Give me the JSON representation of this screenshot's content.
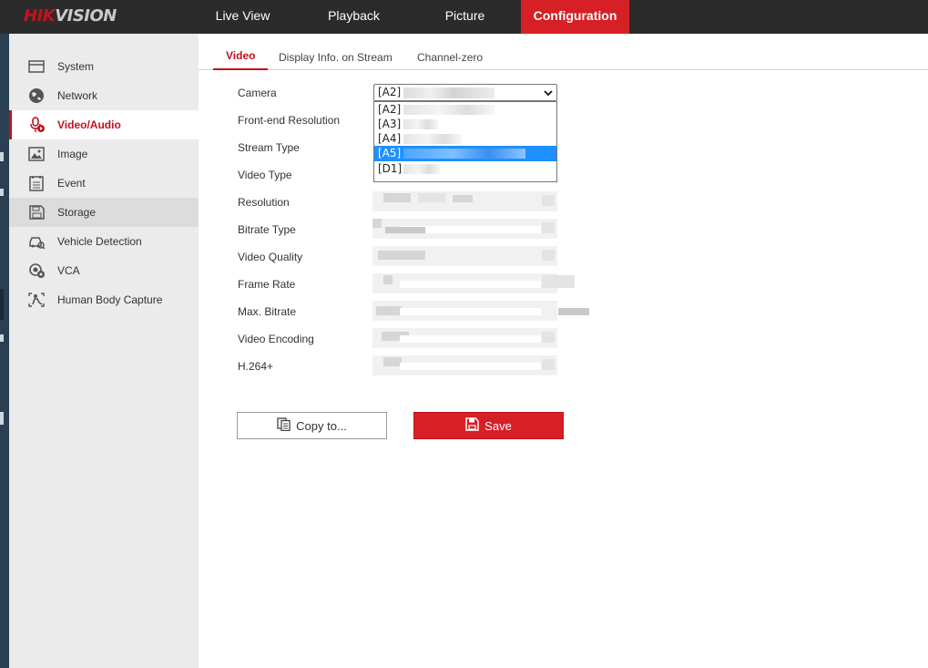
{
  "brand": {
    "logo_left": "HIK",
    "logo_right": "VISION"
  },
  "nav": {
    "items": [
      {
        "label": "Live View"
      },
      {
        "label": "Playback"
      },
      {
        "label": "Picture"
      },
      {
        "label": "Configuration",
        "active": true
      }
    ]
  },
  "sidebar": {
    "items": [
      {
        "label": "System",
        "icon": "system-icon"
      },
      {
        "label": "Network",
        "icon": "globe-icon"
      },
      {
        "label": "Video/Audio",
        "icon": "microphone-icon",
        "active": true
      },
      {
        "label": "Image",
        "icon": "image-icon"
      },
      {
        "label": "Event",
        "icon": "event-icon"
      },
      {
        "label": "Storage",
        "icon": "storage-icon"
      },
      {
        "label": "Vehicle Detection",
        "icon": "vehicle-detection-icon"
      },
      {
        "label": "VCA",
        "icon": "vca-icon"
      },
      {
        "label": "Human Body Capture",
        "icon": "human-body-icon"
      }
    ]
  },
  "tabs": [
    {
      "label": "Video",
      "active": true
    },
    {
      "label": "Display Info. on Stream"
    },
    {
      "label": "Channel-zero"
    }
  ],
  "form": {
    "labels": {
      "camera": "Camera",
      "front_end_resolution": "Front-end Resolution",
      "stream_type": "Stream Type",
      "video_type": "Video Type",
      "resolution": "Resolution",
      "bitrate_type": "Bitrate Type",
      "video_quality": "Video Quality",
      "frame_rate": "Frame Rate",
      "max_bitrate": "Max. Bitrate",
      "video_encoding": "Video Encoding",
      "h264plus": "H.264+"
    },
    "camera": {
      "selected": "[A2]",
      "options": [
        "[A2]",
        "[A3]",
        "[A4]",
        "[A5]",
        "[D1]"
      ],
      "highlighted": "[A5]"
    }
  },
  "buttons": {
    "copy": "Copy to...",
    "save": "Save"
  },
  "colors": {
    "accent": "#d71f26",
    "topbar": "#2b2b2b",
    "sidebar": "#ebebeb",
    "selection": "#1e90ff"
  }
}
